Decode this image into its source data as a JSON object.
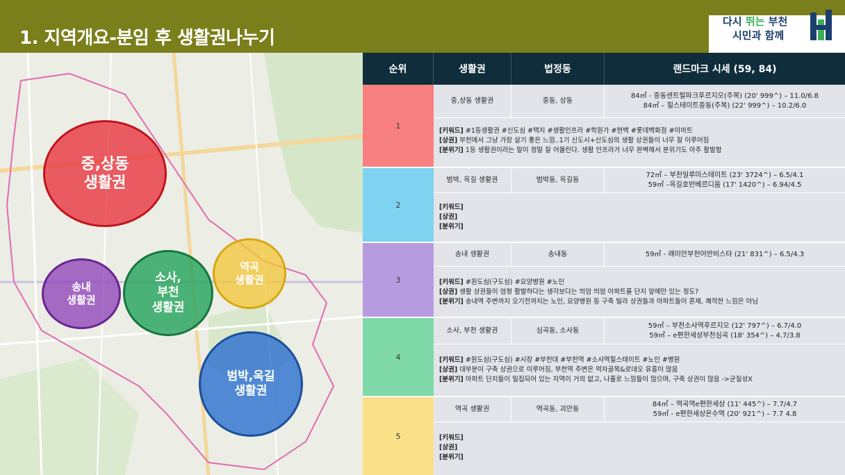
{
  "header": {
    "title": "1. 지역개요-분임 후 생활권나누기",
    "logo_line1_a": "다시 ",
    "logo_line1_b": "뛰는",
    "logo_line1_c": " 부천",
    "logo_line2": "시민과 함께"
  },
  "map": {
    "bubbles": [
      {
        "label": "중,상동\n생활권",
        "color": "#e8323b"
      },
      {
        "label": "송내\n생활권",
        "color": "#8e44b8"
      },
      {
        "label": "소사,\n부천\n생활권",
        "color": "#22a35a"
      },
      {
        "label": "역곡\n생활권",
        "color": "#f2c63a"
      },
      {
        "label": "범박,옥길\n생활권",
        "color": "#2a6fd0"
      }
    ]
  },
  "table": {
    "headers": [
      "순위",
      "생활권",
      "법정동",
      "랜드마크 시세 (59, 84)"
    ],
    "rows": [
      {
        "rank": "1",
        "rank_color": "#f88080",
        "zone": "중,상동 생활권",
        "dong": "중동, 상동",
        "landmarks": [
          "84㎡ - 중동센트럴파크푸르지오(주복) (20' 999^) – 11.0/6.8",
          "84㎡ – 힐스테이트중동(주복) (22' 999^) – 10.2/6.0"
        ],
        "keyword_label": "[키워드]",
        "keyword": " #1등생활권 #신도심 #택지 #생활인프라 #학원가 #현백 #롯데백화점 #이마트",
        "commerce_label": "[상권]",
        "commerce": " 부천에서 그냥 가장 살기 좋은 느낌..1기 신도시+신도심의 생활 상권들이 너무 잘 이루어짐",
        "mood_label": "[분위기]",
        "mood": " 1등 생활권이라는 말이 정말 잘 어울린다. 생활 인프라가 너무 완벽해서 분위기도 아주 활발함"
      },
      {
        "rank": "2",
        "rank_color": "#7fd3f0",
        "zone": "범박, 옥길 생활권",
        "dong": "범박동, 옥길동",
        "landmarks": [
          "72㎡ – 부천일루미스테이트 (23' 3724^) – 6.5/4.1",
          "59㎡ –옥길호반베르디움 (17' 1420^) – 6.94/4.5"
        ],
        "keyword_label": "[키워드]",
        "keyword": "",
        "commerce_label": "[상권]",
        "commerce": "",
        "mood_label": "[분위기]",
        "mood": ""
      },
      {
        "rank": "3",
        "rank_color": "#b79be0",
        "zone": "송내 생활권",
        "dong": "송내동",
        "landmarks": [
          "59㎡ - 래미안부천어반비스타 (21' 831^) – 6.5/4.3"
        ],
        "keyword_label": "[키워드]",
        "keyword": " #원도심(구도심) #요양병원 #노인",
        "commerce_label": "[상권]",
        "commerce": " 생활 상권들이 엄청 활발하다는 생각보다는 띄엄 띄엄 아파트를 단지 앞에만 있는 정도?",
        "mood_label": "[분위기]",
        "mood": " 송내역 주변까지 오기전까지는 노인, 요양병원 등 구축 빌라 상권들과 아파트들이 혼재, 쾌적한 느낌은 아님"
      },
      {
        "rank": "4",
        "rank_color": "#7fd9a8",
        "zone": "소사, 부천 생활권",
        "dong": "심곡동, 소사동",
        "landmarks": [
          "59㎡ – 부천소사역푸르지오 (12' 797^) – 6.7/4.0",
          "59㎡ – e편한세상부천심곡 (18' 354^) – 4.7/3.8"
        ],
        "keyword_label": "[키워드]",
        "keyword": " #원도심(구도심) #시장 #부천대 #부천역 #소사역힐스테이트 #노인 #병원",
        "commerce_label": "[상권]",
        "commerce": " 대부분이 구축 상권으로 이루어짐, 부천역 주변은 먹자골목&로데오 유흥이 많음",
        "mood_label": "[분위기]",
        "mood": " 아파트 단지들이 밀집되어 있는 지역이 거의 없고, 나홀로 느낌들이 많으며, 구축 상권이 많음 ->균질성X"
      },
      {
        "rank": "5",
        "rank_color": "#fbe08a",
        "zone": "역곡 생활권",
        "dong": "역곡동, 괴안동",
        "landmarks": [
          "84㎡ – 역곡역e편한세상 (11' 445^) – 7.7/4.7",
          "59㎡ - e편한세상온수역 (20' 921^) – 7.7 4.8"
        ],
        "keyword_label": "[키워드]",
        "keyword": "",
        "commerce_label": "[상권]",
        "commerce": "",
        "mood_label": "[분위기]",
        "mood": ""
      }
    ]
  }
}
